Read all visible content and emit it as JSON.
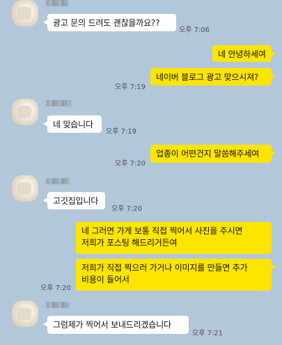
{
  "messages": [
    {
      "id": "m1",
      "direction": "incoming",
      "text": "광고 문의 드려도 괜찮을까요??",
      "time": "오후 7:06"
    },
    {
      "id": "m2",
      "direction": "outgoing",
      "text": "네 안녕하세여",
      "time": ""
    },
    {
      "id": "m3",
      "direction": "outgoing",
      "text": "네이버 블로그 광고 맞으시져?",
      "time": "오후 7:19"
    },
    {
      "id": "m4",
      "direction": "incoming",
      "text": "네 맞습니다",
      "time": "오후 7:19"
    },
    {
      "id": "m5",
      "direction": "outgoing",
      "text": "업종이 어떤건지 말씀해주세여",
      "time": "오후 7:20"
    },
    {
      "id": "m6",
      "direction": "incoming",
      "text": "고깃집입니다",
      "time": "오후 7:20"
    },
    {
      "id": "m7",
      "direction": "incoming",
      "line1": "네 그러면 가게 보통 직접 찍어서 사진을 주시면",
      "line2": "저희가 포스팅 해드리거든여",
      "time": ""
    },
    {
      "id": "m8",
      "direction": "incoming",
      "line1": "저희가 직접 찍으러 가거나 이미지를 만들면 추가",
      "line2": "비용이 들어서",
      "time": "오후 7:20"
    },
    {
      "id": "m9",
      "direction": "incoming",
      "text": "그럼제가 찍어서 보내드리겠습니다",
      "time": "오후 7:21"
    }
  ],
  "colors": {
    "background": "#b2c7d9",
    "incoming_bubble": "#ffffff",
    "outgoing_bubble": "#fee500",
    "timestamp": "#4a4f55"
  }
}
